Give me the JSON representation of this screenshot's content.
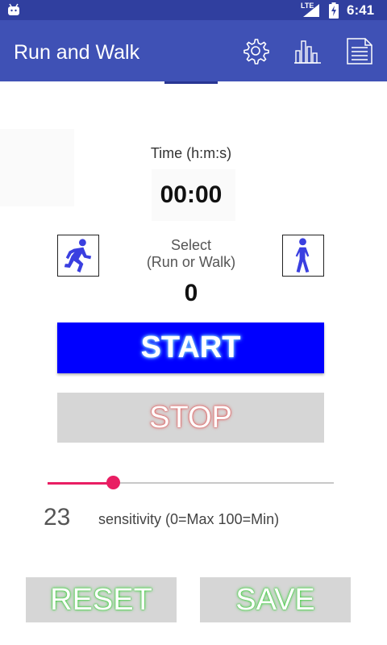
{
  "status_bar": {
    "network": "LTE",
    "time": "6:41",
    "icons": [
      "android-icon",
      "signal-icon",
      "battery-charging-icon"
    ]
  },
  "app_bar": {
    "title": "Run and Walk",
    "actions": [
      "settings-icon",
      "bar-chart-icon",
      "document-icon"
    ]
  },
  "timer": {
    "label": "Time (h:m:s)",
    "value": "00:00"
  },
  "mode": {
    "label_line1": "Select",
    "label_line2": "(Run or Walk)",
    "count": "0",
    "run_icon": "running-person-icon",
    "walk_icon": "walking-person-icon"
  },
  "controls": {
    "start_label": "START",
    "stop_label": "STOP"
  },
  "sensitivity": {
    "value": "23",
    "label": "sensitivity (0=Max 100=Min)",
    "slider_fraction": 0.23
  },
  "footer": {
    "reset_label": "RESET",
    "save_label": "SAVE"
  },
  "colors": {
    "primary": "#3f51b5",
    "primary_dark": "#303f9f",
    "start_button": "#0000ff",
    "accent": "#e91e63",
    "disabled_button": "#d6d6d6"
  }
}
